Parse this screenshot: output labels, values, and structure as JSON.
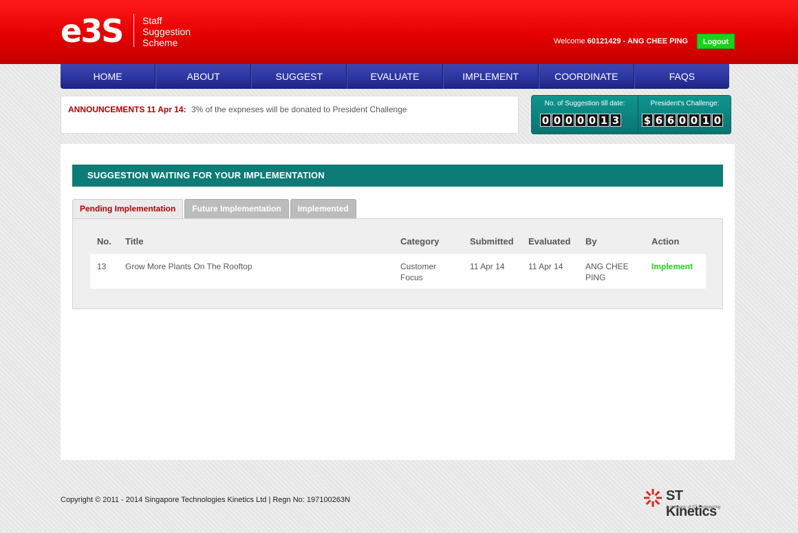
{
  "header": {
    "logo_text": "e3S",
    "tagline": [
      "Staff",
      "Suggestion",
      "Scheme"
    ],
    "welcome_prefix": "Welcome",
    "user_id_name": "60121429 - ANG CHEE PING",
    "logout_label": "Logout"
  },
  "nav": {
    "items": [
      {
        "label": "HOME"
      },
      {
        "label": "ABOUT"
      },
      {
        "label": "SUGGEST"
      },
      {
        "label": "EVALUATE"
      },
      {
        "label": "IMPLEMENT"
      },
      {
        "label": "COORDINATE"
      },
      {
        "label": "FAQS"
      }
    ]
  },
  "announcement": {
    "label": "ANNOUNCEMENTS 11 Apr 14:",
    "text": "3% of the expneses will be donated to President Challenge"
  },
  "counters": {
    "suggestions_label": "No. of Suggestion till date:",
    "suggestions_digits": [
      "0",
      "0",
      "0",
      "0",
      "0",
      "1",
      "3"
    ],
    "challenge_label": "President's Challenge:",
    "challenge_digits": [
      "$",
      "6",
      "6",
      "0",
      "0",
      "1",
      "0"
    ]
  },
  "main": {
    "section_title": "SUGGESTION WAITING FOR YOUR IMPLEMENTATION",
    "tabs": [
      {
        "label": "Pending Implementation",
        "active": true
      },
      {
        "label": "Future Implementation",
        "active": false
      },
      {
        "label": "Implemented",
        "active": false
      }
    ],
    "table": {
      "columns": [
        "No.",
        "Title",
        "Category",
        "Submitted",
        "Evaluated",
        "By",
        "Action"
      ],
      "rows": [
        {
          "no": "13",
          "title": "Grow More Plants On The Rooftop",
          "category_lines": [
            "Customer",
            "Focus"
          ],
          "submitted": "11 Apr 14",
          "evaluated": "11 Apr 14",
          "by_lines": [
            "ANG CHEE",
            "PING"
          ],
          "action": "Implement"
        }
      ]
    }
  },
  "footer": {
    "copyright": "Copyright © 2011 - 2014 Singapore Technologies Kinetics Ltd | Regn No: 197100263N",
    "brand_name": "ST Kinetics",
    "brand_sub": "A company of ST Engineering"
  },
  "colors": {
    "header_red": "#e40000",
    "nav_blue": "#2b35a0",
    "teal": "#0d7b76",
    "action_green": "#19d31a",
    "accent_red": "#b00000"
  }
}
